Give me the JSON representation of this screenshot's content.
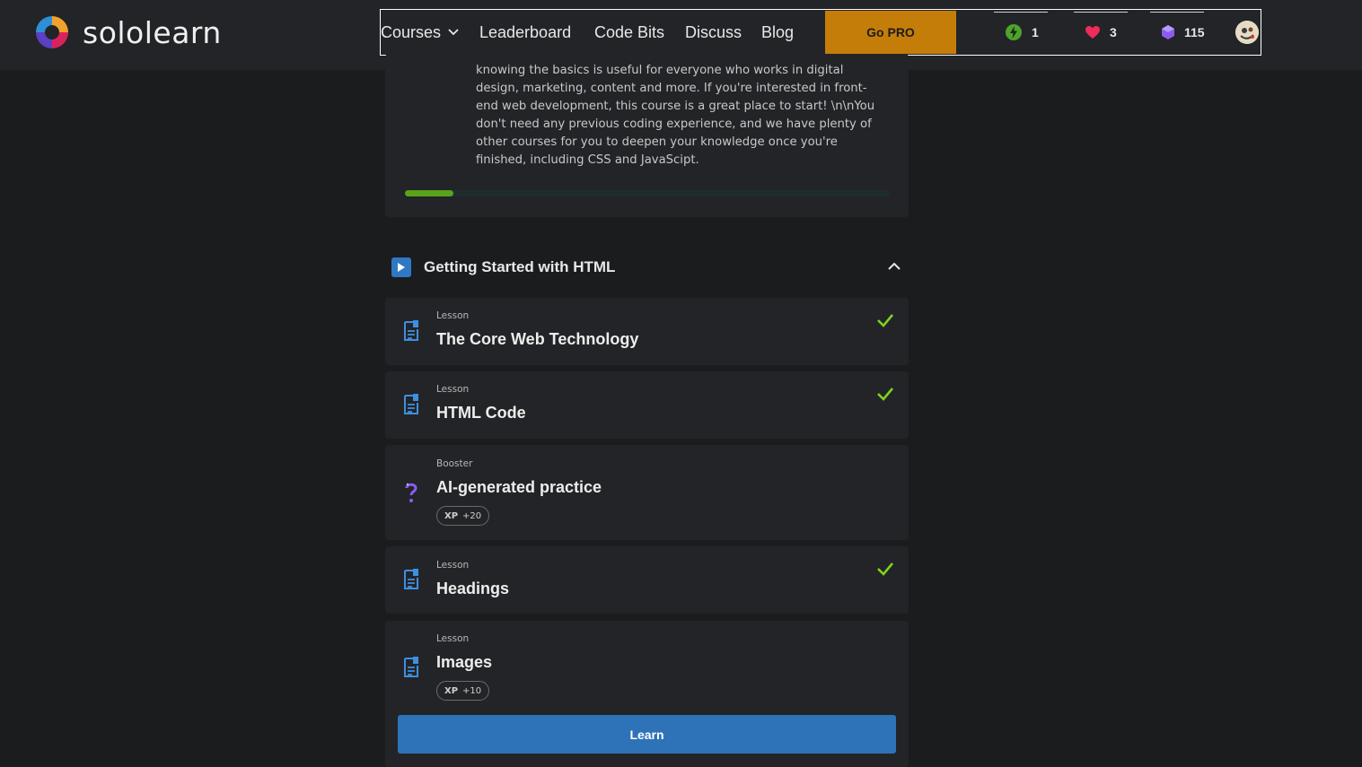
{
  "brand": {
    "name": "sololearn"
  },
  "nav": {
    "courses": "Courses",
    "leaderboard": "Leaderboard",
    "code_bits": "Code Bits",
    "discuss": "Discuss",
    "blog": "Blog",
    "go_pro": "Go PRO"
  },
  "stats": {
    "streak": "1",
    "hearts": "3",
    "gems": "115"
  },
  "course": {
    "description": "knowing the basics is useful for everyone who works in digital design, marketing, content and more. If you're interested in front-end web development, this course is a great place to start! \\n\\nYou don't need any previous coding experience, and we have plenty of other courses for you to deepen your knowledge once you're finished, including CSS and JavaScipt.",
    "progress_fraction": 0.1
  },
  "module": {
    "title": "Getting Started with HTML",
    "items": [
      {
        "kind": "Lesson",
        "title": "The Core Web Technology",
        "completed": true
      },
      {
        "kind": "Lesson",
        "title": "HTML Code",
        "completed": true
      },
      {
        "kind": "Booster",
        "title": "AI-generated practice",
        "completed": false,
        "xp_label": "XP",
        "xp_value": "+20"
      },
      {
        "kind": "Lesson",
        "title": "Headings",
        "completed": true
      },
      {
        "kind": "Lesson",
        "title": "Images",
        "completed": false,
        "xp_label": "XP",
        "xp_value": "+10"
      }
    ],
    "learn_button": "Learn"
  },
  "colors": {
    "accent_blue": "#2e73b8",
    "pro_orange": "#c57d0a",
    "check_green": "#7ed321",
    "progress_green": "#5aa31c"
  },
  "icons": {
    "streak": "lightning-icon",
    "hearts": "heart-icon",
    "gems": "gem-icon",
    "lesson": "document-icon",
    "booster": "question-icon",
    "complete": "check-icon"
  }
}
